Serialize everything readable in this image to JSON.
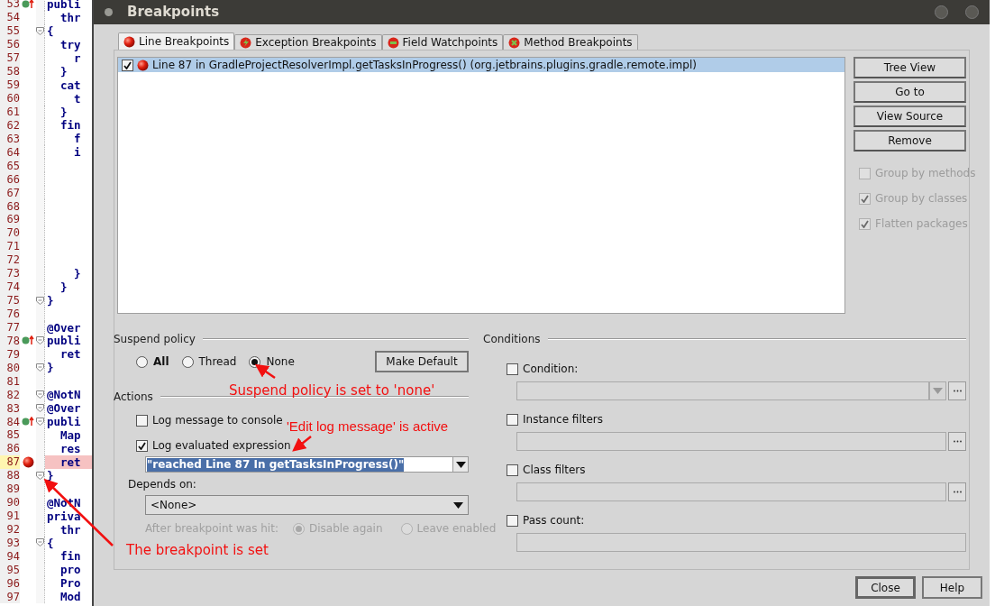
{
  "editor": {
    "lines": [
      {
        "number": "53",
        "code": "publi",
        "kind": "override",
        "fold": false,
        "highlighted": false
      },
      {
        "number": "54",
        "code": "  thr",
        "fold": false,
        "highlighted": false
      },
      {
        "number": "55",
        "code": "{",
        "fold": true,
        "highlighted": false
      },
      {
        "number": "56",
        "code": "  try",
        "fold": false,
        "highlighted": false
      },
      {
        "number": "57",
        "code": "    r",
        "fold": false,
        "highlighted": false
      },
      {
        "number": "58",
        "code": "  }",
        "fold": false,
        "highlighted": false
      },
      {
        "number": "59",
        "code": "  cat",
        "fold": false,
        "highlighted": false
      },
      {
        "number": "60",
        "code": "    t",
        "fold": false,
        "highlighted": false
      },
      {
        "number": "61",
        "code": "  }",
        "fold": false,
        "highlighted": false
      },
      {
        "number": "62",
        "code": "  fin",
        "fold": false,
        "highlighted": false
      },
      {
        "number": "63",
        "code": "    f",
        "fold": false,
        "highlighted": false
      },
      {
        "number": "64",
        "code": "    i",
        "fold": false,
        "highlighted": false
      },
      {
        "number": "65",
        "fold": false,
        "highlighted": false
      },
      {
        "number": "66",
        "fold": false,
        "highlighted": false
      },
      {
        "number": "67",
        "fold": false,
        "highlighted": false
      },
      {
        "number": "68",
        "fold": false,
        "highlighted": false
      },
      {
        "number": "69",
        "fold": false,
        "highlighted": false
      },
      {
        "number": "70",
        "fold": false,
        "highlighted": false
      },
      {
        "number": "71",
        "fold": false,
        "highlighted": false
      },
      {
        "number": "72",
        "fold": false,
        "highlighted": false
      },
      {
        "number": "73",
        "code": "    }",
        "fold": false,
        "highlighted": false
      },
      {
        "number": "74",
        "code": "  }",
        "fold": false,
        "highlighted": false
      },
      {
        "number": "75",
        "code": "}",
        "fold": true,
        "highlighted": false
      },
      {
        "number": "76",
        "fold": false,
        "highlighted": false
      },
      {
        "number": "77",
        "code": "@Over",
        "fold": false,
        "highlighted": false
      },
      {
        "number": "78",
        "code": "publi",
        "kind": "override",
        "fold": true,
        "highlighted": false
      },
      {
        "number": "79",
        "code": "  ret",
        "fold": false,
        "highlighted": false
      },
      {
        "number": "80",
        "code": "}",
        "fold": true,
        "highlighted": false
      },
      {
        "number": "81",
        "fold": false,
        "highlighted": false
      },
      {
        "number": "82",
        "code": "@NotN",
        "fold": true,
        "highlighted": false
      },
      {
        "number": "83",
        "code": "@Over",
        "fold": true,
        "highlighted": false
      },
      {
        "number": "84",
        "code": "publi",
        "kind": "override",
        "fold": true,
        "highlighted": false
      },
      {
        "number": "85",
        "code": "  Map",
        "fold": false,
        "highlighted": false
      },
      {
        "number": "86",
        "code": "  res",
        "fold": false,
        "highlighted": false
      },
      {
        "number": "87",
        "code": "  ret",
        "kind": "breakpoint",
        "fold": false,
        "highlighted": true
      },
      {
        "number": "88",
        "code": "}",
        "fold": true,
        "highlighted": false
      },
      {
        "number": "89",
        "fold": false,
        "highlighted": false
      },
      {
        "number": "90",
        "code": "@NotN",
        "fold": false,
        "highlighted": false
      },
      {
        "number": "91",
        "code": "priva",
        "fold": false,
        "highlighted": false
      },
      {
        "number": "92",
        "code": "  thr",
        "fold": false,
        "highlighted": false
      },
      {
        "number": "93",
        "code": "{",
        "fold": true,
        "highlighted": false
      },
      {
        "number": "94",
        "code": "  fin",
        "fold": false,
        "highlighted": false
      },
      {
        "number": "95",
        "code": "  pro",
        "fold": false,
        "highlighted": false
      },
      {
        "number": "96",
        "code": "  Pro",
        "fold": false,
        "highlighted": false
      },
      {
        "number": "97",
        "code": "  Mod",
        "fold": false,
        "highlighted": false
      }
    ]
  },
  "window": {
    "title": "Breakpoints"
  },
  "tabs": [
    {
      "label": "Line Breakpoints",
      "kind": "line",
      "selected": true
    },
    {
      "label": "Exception Breakpoints",
      "kind": "exception",
      "selected": false
    },
    {
      "label": "Field Watchpoints",
      "kind": "field",
      "selected": false
    },
    {
      "label": "Method Breakpoints",
      "kind": "method",
      "selected": false
    }
  ],
  "breakpoints": [
    {
      "label": "Line 87 in GradleProjectResolverImpl.getTasksInProgress() (org.jetbrains.plugins.gradle.remote.impl)",
      "checked": true,
      "selected": true
    }
  ],
  "side_buttons": [
    "Tree View",
    "Go to",
    "View Source",
    "Remove"
  ],
  "side_options": [
    {
      "label": "Group by methods",
      "checked": false,
      "disabled": true
    },
    {
      "label": "Group by classes",
      "checked": true,
      "disabled": true
    },
    {
      "label": "Flatten packages",
      "checked": true,
      "disabled": true
    }
  ],
  "suspend_policy": {
    "title": "Suspend policy",
    "options": [
      {
        "label": "All",
        "selected": false,
        "bold": true
      },
      {
        "label": "Thread",
        "selected": false,
        "bold": false
      },
      {
        "label": "None",
        "selected": true,
        "bold": false
      }
    ],
    "button": "Make Default"
  },
  "actions": {
    "title": "Actions",
    "log_message": {
      "label": "Log message to console",
      "checked": false
    },
    "log_expression": {
      "label": "Log evaluated expression",
      "checked": true,
      "value": "\"reached Line 87 In getTasksInProgress()\""
    },
    "depends_on": {
      "label": "Depends on:",
      "value": "<None>"
    },
    "after_hit": {
      "label": "After breakpoint was hit:",
      "options": [
        {
          "label": "Disable again",
          "selected": true
        },
        {
          "label": "Leave enabled",
          "selected": false
        }
      ]
    }
  },
  "conditions": {
    "title": "Conditions",
    "items": [
      {
        "label": "Condition:",
        "checked": false,
        "kind": "combo"
      },
      {
        "label": "Instance filters",
        "checked": false,
        "kind": "browse"
      },
      {
        "label": "Class filters",
        "checked": false,
        "kind": "browse"
      },
      {
        "label": "Pass count:",
        "checked": false,
        "kind": "text"
      }
    ]
  },
  "footer_buttons": [
    {
      "label": "Close",
      "default": true
    },
    {
      "label": "Help",
      "default": false
    }
  ],
  "annotations": [
    "Suspend policy is set to 'none'",
    "'Edit log message' is active",
    "The breakpoint is set"
  ]
}
